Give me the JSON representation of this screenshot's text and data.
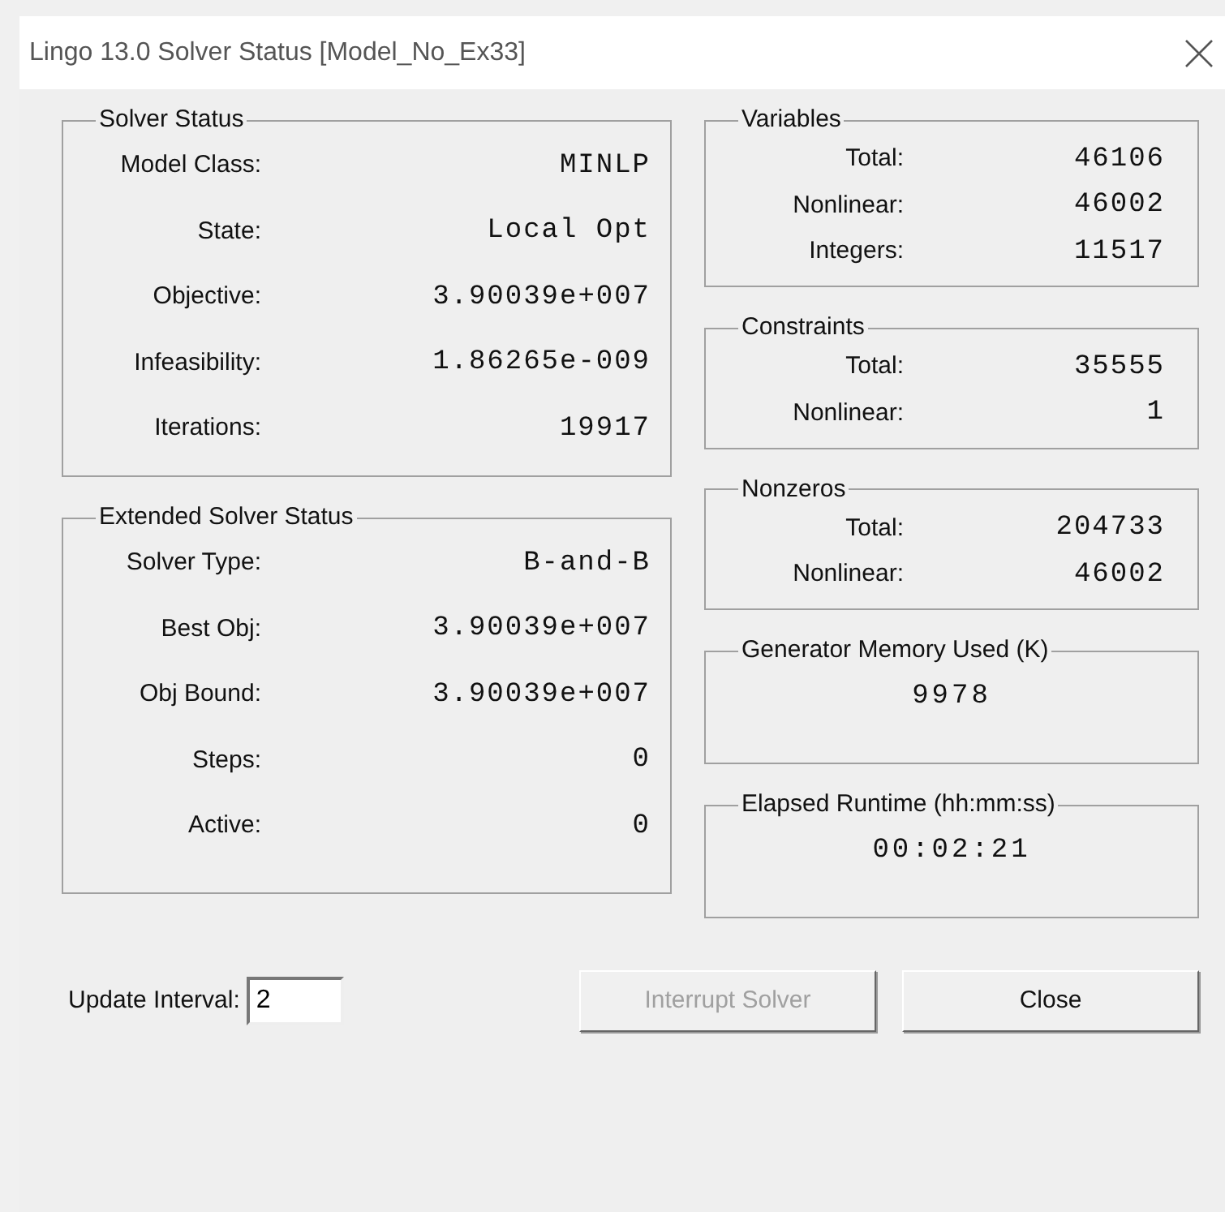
{
  "window": {
    "title": "Lingo 13.0 Solver Status [Model_No_Ex33]"
  },
  "left_groups": [
    {
      "title": "Solver Status",
      "rows": [
        {
          "label": "Model Class:",
          "value": "MINLP"
        },
        {
          "label": "State:",
          "value": "Local Opt"
        },
        {
          "label": "Objective:",
          "value": "3.90039e+007"
        },
        {
          "label": "Infeasibility:",
          "value": "1.86265e-009"
        },
        {
          "label": "Iterations:",
          "value": "19917"
        }
      ]
    },
    {
      "title": "Extended Solver Status",
      "rows": [
        {
          "label": "Solver Type:",
          "value": "B-and-B"
        },
        {
          "label": "Best Obj:",
          "value": "3.90039e+007"
        },
        {
          "label": "Obj Bound:",
          "value": "3.90039e+007"
        },
        {
          "label": "Steps:",
          "value": "0"
        },
        {
          "label": "Active:",
          "value": "0"
        }
      ]
    }
  ],
  "right_groups": [
    {
      "title": "Variables",
      "rows": [
        {
          "label": "Total:",
          "value": "46106"
        },
        {
          "label": "Nonlinear:",
          "value": "46002"
        },
        {
          "label": "Integers:",
          "value": "11517"
        }
      ]
    },
    {
      "title": "Constraints",
      "rows": [
        {
          "label": "Total:",
          "value": "35555"
        },
        {
          "label": "Nonlinear:",
          "value": "1"
        }
      ]
    },
    {
      "title": "Nonzeros",
      "rows": [
        {
          "label": "Total:",
          "value": "204733"
        },
        {
          "label": "Nonlinear:",
          "value": "46002"
        }
      ]
    },
    {
      "title": "Generator Memory Used (K)",
      "value": "9978"
    },
    {
      "title": "Elapsed Runtime (hh:mm:ss)",
      "value": "00:02:21"
    }
  ],
  "update_interval": {
    "label": "Update Interval:",
    "value": "2"
  },
  "buttons": [
    {
      "label": "Interrupt Solver",
      "disabled": true
    },
    {
      "label": "Close",
      "disabled": false
    }
  ]
}
